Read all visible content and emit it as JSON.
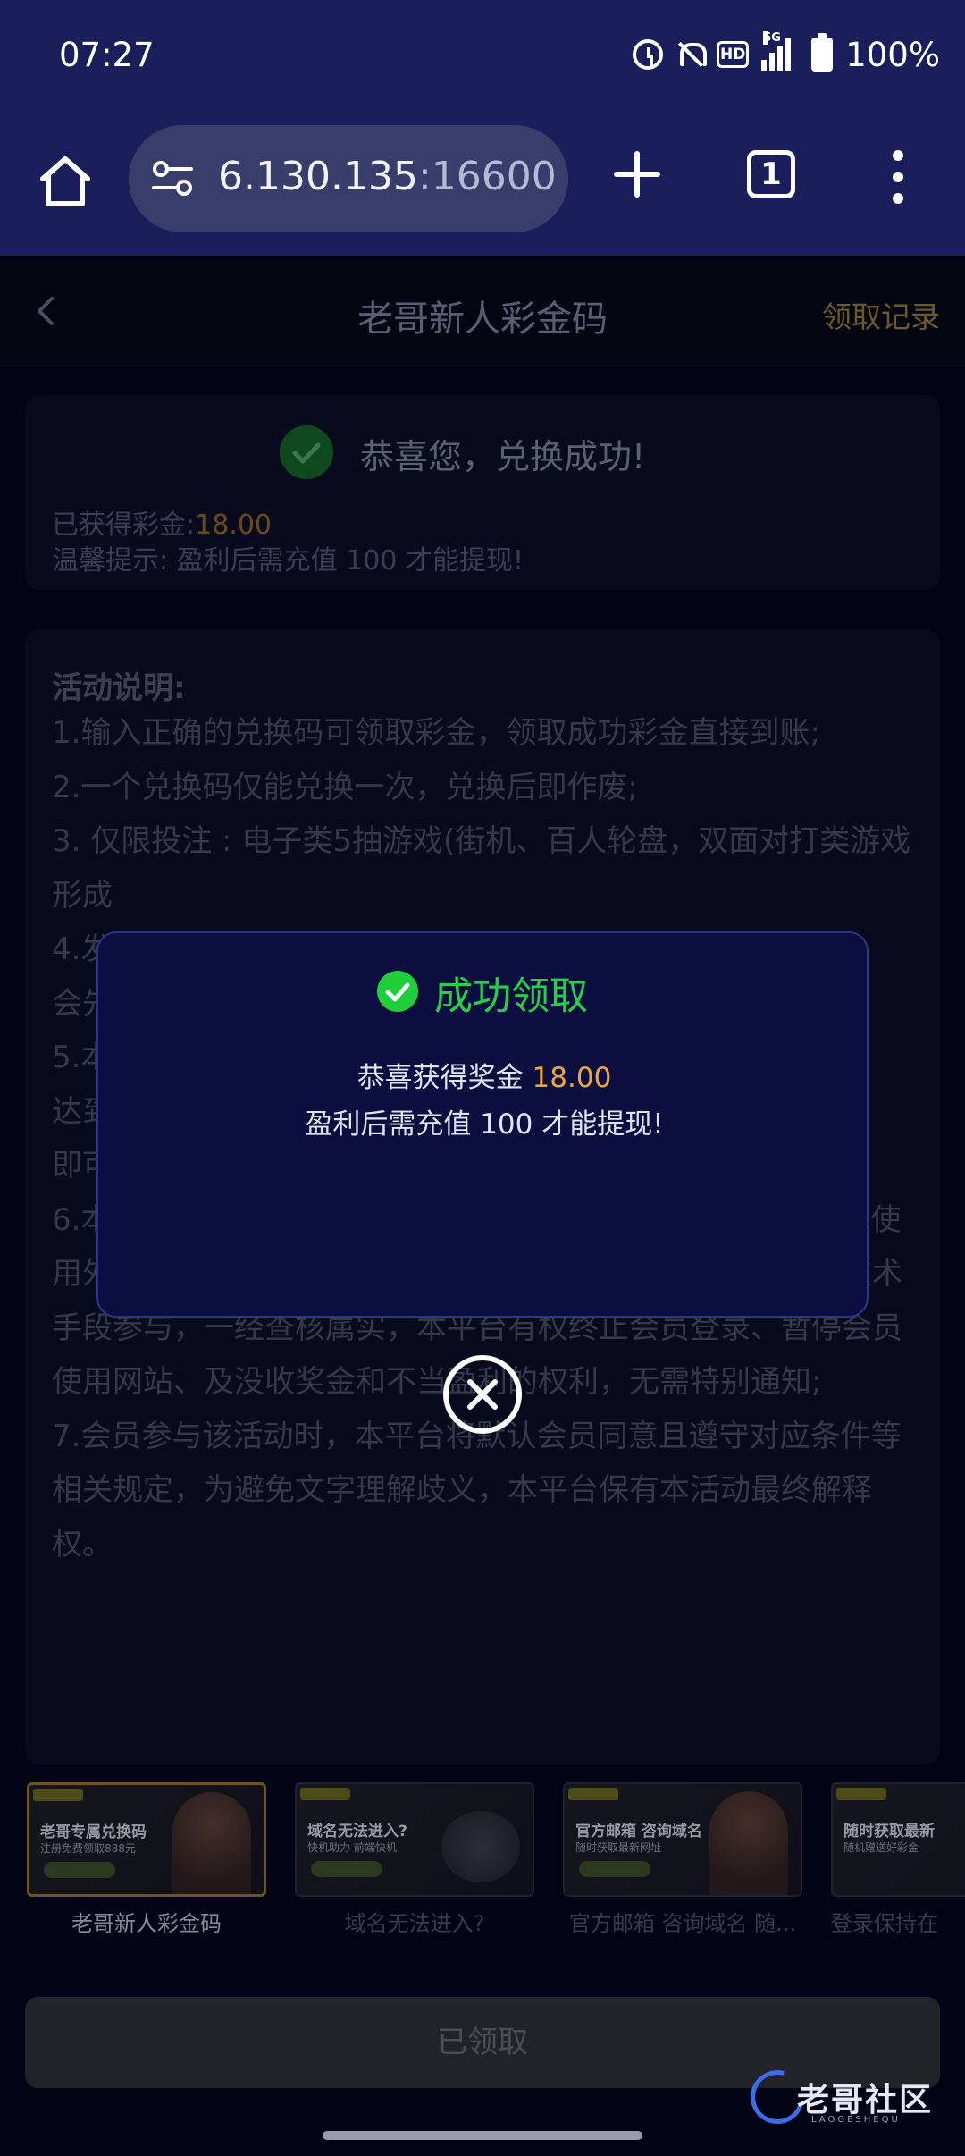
{
  "status_bar": {
    "time": "07:27",
    "network": "5G",
    "hd_label": "HD",
    "battery": "100%"
  },
  "browser": {
    "url_host": "6.130.135",
    "url_port": ":16600",
    "tab_count": "1"
  },
  "header": {
    "title": "老哥新人彩金码",
    "records_label": "领取记录"
  },
  "result_card": {
    "headline": "恭喜您，兑换成功!",
    "earned_label": "已获得彩金:",
    "earned_amount": "18.00",
    "hint": "温馨提示: 盈利后需充值 100 才能提现!"
  },
  "rules": {
    "title": "活动说明:",
    "items": [
      "1.输入正确的兑换码可领取彩金，领取成功彩金直接到账;",
      "2.一个兑换码仅能兑换一次，兑换后即作废;",
      "3. 仅限投注 : 电子类5抽游戏(街机、百人轮盘，双面对打类游戏",
      "形成",
      "4.发",
      "会先",
      "5.本",
      "达到",
      "即可",
      "6.本活动仅限账号本人进行兑换码兑换，禁止租借账号，不得使用外挂程式、机器人、利用协议、漏洞、接口、群控或其他技术手段参与，一经查核属实，本平台有权终止会员登录、暂停会员使用网站、及没收奖金和不当盈利的权利，无需特别通知;",
      "7.会员参与该活动时，本平台将默认会员同意且遵守对应条件等相关规定，为避免文字理解歧义，本平台保有本活动最终解释权。"
    ]
  },
  "promos": [
    {
      "caption": "老哥新人彩金码",
      "thumb_title": "老哥专属兑换码",
      "thumb_sub": "注册免费领取888元",
      "active": true
    },
    {
      "caption": "域名无法进入?",
      "thumb_title": "域名无法进入?",
      "thumb_sub": "快机助力 前端快机",
      "active": false
    },
    {
      "caption": "官方邮箱 咨询域名 随...",
      "thumb_title": "官方邮箱 咨询域名",
      "thumb_sub": "随时获取最新网址",
      "active": false
    },
    {
      "caption": "登录保持在",
      "thumb_title": "随时获取最新",
      "thumb_sub": "随机赠送好彩金",
      "active": false
    }
  ],
  "claim_button": "已领取",
  "brand": {
    "name": "老哥社区",
    "sub": "LAOGESHEQU"
  },
  "modal": {
    "title": "成功领取",
    "line1_prefix": "恭喜获得奖金 ",
    "amount": "18.00",
    "line2": "盈利后需充值 100 才能提现!"
  },
  "colors": {
    "accent_gold": "#f2a531",
    "success_green": "#28d04a",
    "browser_bg": "#1a1f5b",
    "modal_bg": "#0b0e3f"
  },
  "icons": [
    "home-icon",
    "site-settings-icon",
    "plus-icon",
    "tabs-icon",
    "more-vert-icon",
    "back-icon",
    "check-icon",
    "close-icon",
    "alarm-icon",
    "bell-off-icon",
    "signal-icon",
    "battery-icon"
  ]
}
